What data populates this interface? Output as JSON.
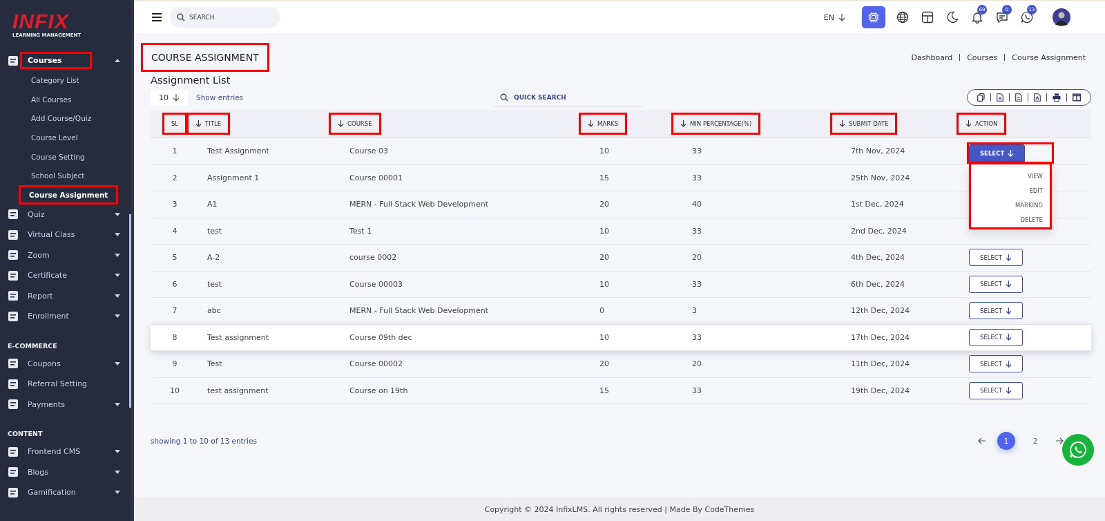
{
  "sidebar": {
    "logo": {
      "name": "INFIX",
      "tagline": "LEARNING MANAGEMENT"
    },
    "sections": [
      {
        "items": [
          {
            "label": "Courses",
            "has_submenu": true,
            "expanded": true,
            "highlighted": true,
            "children": [
              {
                "label": "Category List",
                "selected": false,
                "highlighted": false
              },
              {
                "label": "All Courses",
                "selected": false,
                "highlighted": false
              },
              {
                "label": "Add Course/Quiz",
                "selected": false,
                "highlighted": false
              },
              {
                "label": "Course Level",
                "selected": false,
                "highlighted": false
              },
              {
                "label": "Course Setting",
                "selected": false,
                "highlighted": false
              },
              {
                "label": "School Subject",
                "selected": false,
                "highlighted": false
              },
              {
                "label": "Course Assignment",
                "selected": true,
                "highlighted": true
              }
            ]
          },
          {
            "label": "Quiz",
            "has_submenu": true,
            "expanded": false,
            "highlighted": false
          },
          {
            "label": "Virtual Class",
            "has_submenu": true,
            "expanded": false,
            "highlighted": false
          },
          {
            "label": "Zoom",
            "has_submenu": true,
            "expanded": false,
            "highlighted": false
          },
          {
            "label": "Certificate",
            "has_submenu": true,
            "expanded": false,
            "highlighted": false
          },
          {
            "label": "Report",
            "has_submenu": true,
            "expanded": false,
            "highlighted": false
          },
          {
            "label": "Enrollment",
            "has_submenu": true,
            "expanded": false,
            "highlighted": false
          }
        ]
      },
      {
        "heading": "E-COMMERCE",
        "items": [
          {
            "label": "Coupons",
            "has_submenu": true,
            "expanded": false,
            "highlighted": false
          },
          {
            "label": "Referral Setting",
            "has_submenu": false,
            "expanded": false,
            "highlighted": false
          },
          {
            "label": "Payments",
            "has_submenu": true,
            "expanded": false,
            "highlighted": false
          }
        ]
      },
      {
        "heading": "CONTENT",
        "items": [
          {
            "label": "Frontend CMS",
            "has_submenu": true,
            "expanded": false,
            "highlighted": false
          },
          {
            "label": "Blogs",
            "has_submenu": true,
            "expanded": false,
            "highlighted": false
          },
          {
            "label": "Gamification",
            "has_submenu": true,
            "expanded": false,
            "highlighted": false
          }
        ]
      }
    ]
  },
  "topbar": {
    "search": {
      "placeholder": "SEARCH"
    },
    "language": "EN",
    "badges": [
      "69",
      "0",
      "13"
    ]
  },
  "page": {
    "title": "COURSE ASSIGNMENT",
    "title_highlighted": true,
    "breadcrumb": [
      "Dashboard",
      "Courses",
      "Course Assignment"
    ],
    "list_title": "Assignment List",
    "page_size": "10",
    "show_entries": "Show entries",
    "quick_search": {
      "placeholder": "QUICK SEARCH"
    }
  },
  "table": {
    "columns": [
      {
        "label": "SL",
        "sortable": false,
        "highlighted": true
      },
      {
        "label": "TITLE",
        "sortable": true,
        "highlighted": true
      },
      {
        "label": "COURSE",
        "sortable": true,
        "highlighted": true
      },
      {
        "label": "MARKS",
        "sortable": true,
        "highlighted": true
      },
      {
        "label": "MIN PERCENTAGE(%)",
        "sortable": true,
        "highlighted": true
      },
      {
        "label": "SUBMIT DATE",
        "sortable": true,
        "highlighted": true
      },
      {
        "label": "ACTION",
        "sortable": true,
        "highlighted": true
      }
    ],
    "rows": [
      {
        "cells": [
          "1",
          "Test Assignment",
          "Course 03",
          "10",
          "33",
          "7th Nov, 2024"
        ],
        "action": "SELECT",
        "menu_open": true,
        "hovered": false
      },
      {
        "cells": [
          "2",
          "Assignment 1",
          "Course 00001",
          "15",
          "33",
          "25th Nov, 2024"
        ],
        "menu_open": false,
        "hovered": false
      },
      {
        "cells": [
          "3",
          "A1",
          "MERN - Full Stack Web Development",
          "20",
          "40",
          "1st Dec, 2024"
        ],
        "menu_open": false,
        "hovered": false
      },
      {
        "cells": [
          "4",
          "test",
          "Test 1",
          "10",
          "33",
          "2nd Dec, 2024"
        ],
        "menu_open": false,
        "hovered": false
      },
      {
        "cells": [
          "5",
          "A-2",
          "course 0002",
          "20",
          "20",
          "4th Dec, 2024"
        ],
        "action": "SELECT",
        "menu_open": false,
        "hovered": false
      },
      {
        "cells": [
          "6",
          "test",
          "Course 00003",
          "10",
          "33",
          "6th Dec, 2024"
        ],
        "action": "SELECT",
        "menu_open": false,
        "hovered": false
      },
      {
        "cells": [
          "7",
          "abc",
          "MERN - Full Stack Web Development",
          "0",
          "3",
          "12th Dec, 2024"
        ],
        "action": "SELECT",
        "menu_open": false,
        "hovered": false
      },
      {
        "cells": [
          "8",
          "Test assignment",
          "Course 09th dec",
          "10",
          "33",
          "17th Dec, 2024"
        ],
        "action": "SELECT",
        "menu_open": false,
        "hovered": true
      },
      {
        "cells": [
          "9",
          "Test",
          "Course 00002",
          "20",
          "20",
          "11th Dec, 2024"
        ],
        "action": "SELECT",
        "menu_open": false,
        "hovered": false
      },
      {
        "cells": [
          "10",
          "test assignment",
          "Course on 19th",
          "15",
          "33",
          "19th Dec, 2024"
        ],
        "action": "SELECT",
        "menu_open": false,
        "hovered": false
      }
    ]
  },
  "action_menu": {
    "items": [
      "VIEW",
      "EDIT",
      "MARKING",
      "DELETE"
    ],
    "highlighted": true
  },
  "summary": "showing 1 to 10 of 13 entries",
  "pagination": {
    "pages": [
      {
        "label": "1",
        "selected": true
      },
      {
        "label": "2",
        "selected": false
      }
    ]
  },
  "footer": "Copyright © 2024 InfixLMS. All rights reserved | Made By CodeThemes"
}
